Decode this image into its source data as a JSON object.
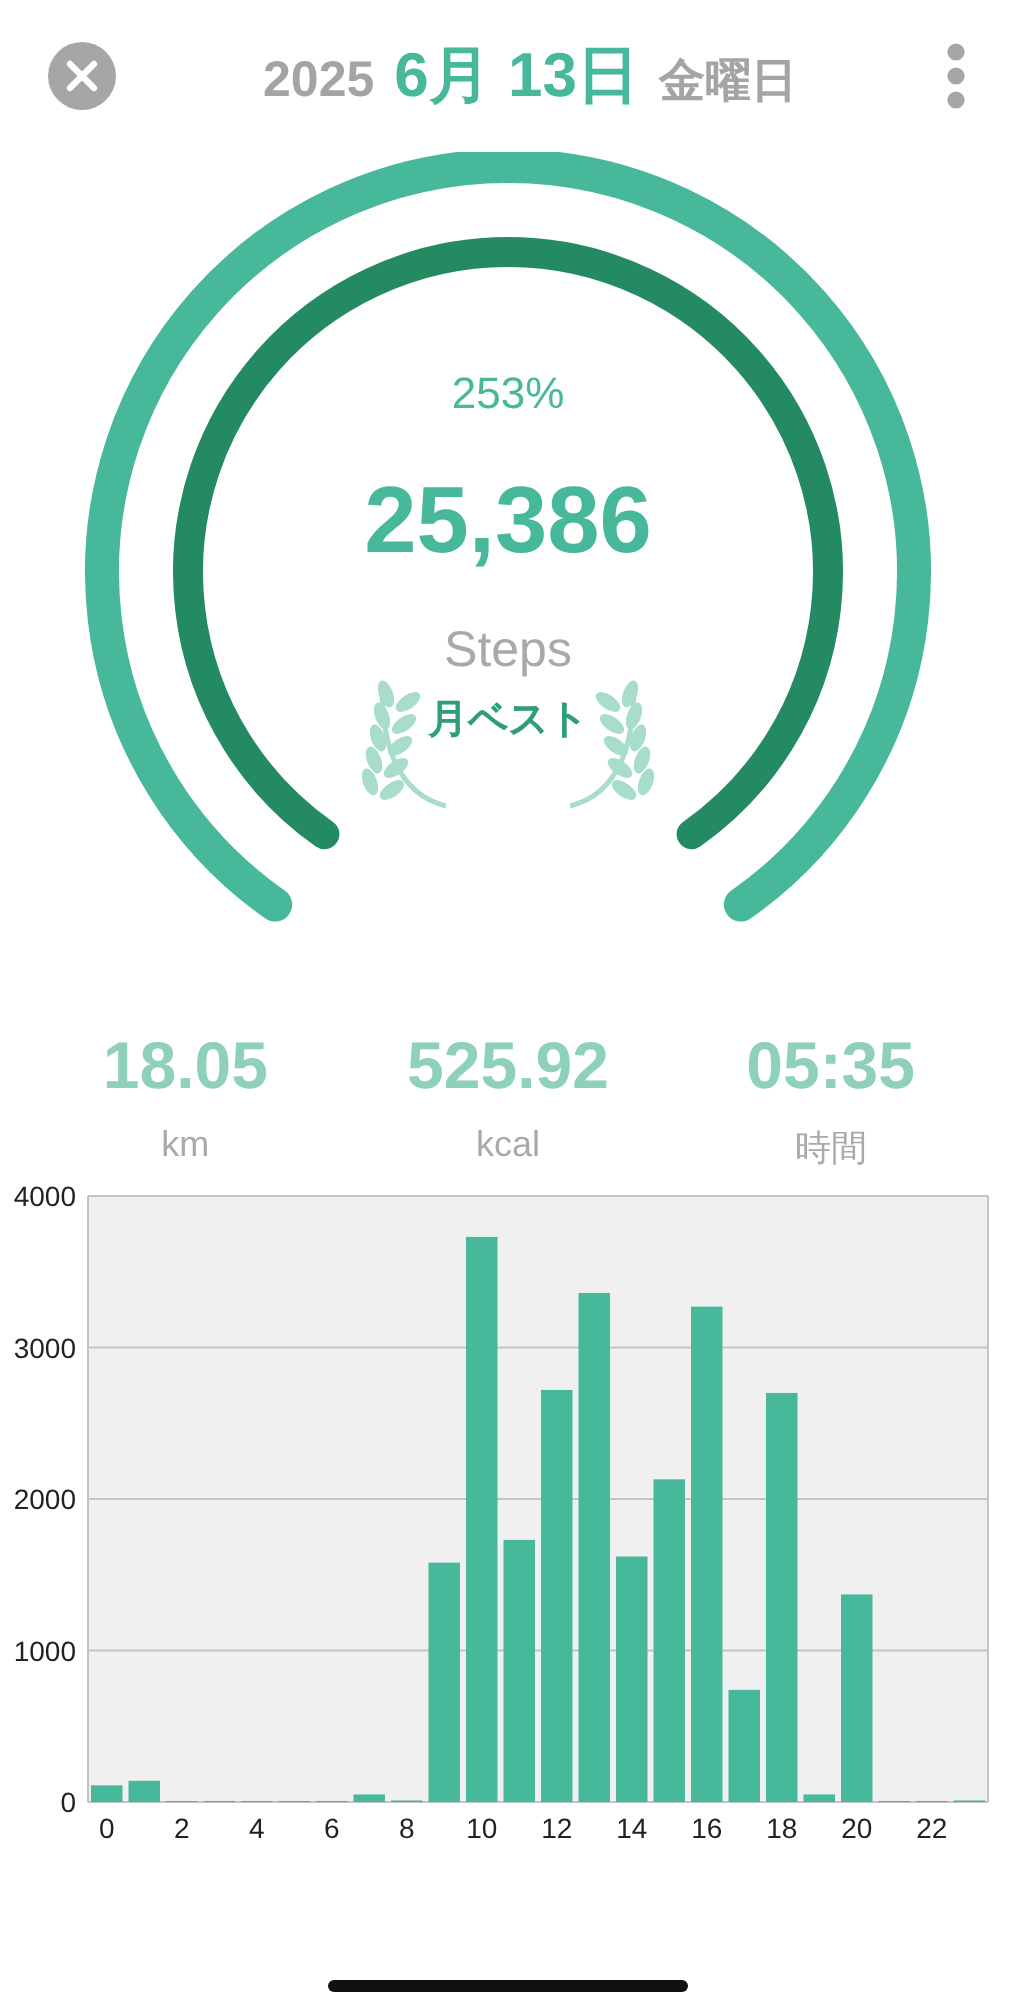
{
  "header": {
    "year": "2025",
    "date": "6月 13日",
    "weekday": "金曜日"
  },
  "gauge": {
    "percent": "253%",
    "steps": "25,386",
    "unit": "Steps",
    "badge": "月ベスト"
  },
  "stats": [
    {
      "value": "18.05",
      "label": "km"
    },
    {
      "value": "525.92",
      "label": "kcal"
    },
    {
      "value": "05:35",
      "label": "時間"
    }
  ],
  "chart_data": {
    "type": "bar",
    "x": [
      0,
      1,
      2,
      3,
      4,
      5,
      6,
      7,
      8,
      9,
      10,
      11,
      12,
      13,
      14,
      15,
      16,
      17,
      18,
      19,
      20,
      21,
      22,
      23
    ],
    "values": [
      110,
      140,
      0,
      0,
      0,
      0,
      0,
      50,
      10,
      1580,
      3730,
      1730,
      2720,
      3360,
      1620,
      2130,
      3270,
      740,
      2700,
      50,
      1370,
      0,
      0,
      10
    ],
    "grid": true,
    "xlim": [
      -0.5,
      23.5
    ],
    "ylim": [
      0,
      4000
    ],
    "xticks": [
      0,
      2,
      4,
      6,
      8,
      10,
      12,
      14,
      16,
      18,
      20,
      22
    ],
    "yticks": [
      0,
      1000,
      2000,
      3000,
      4000
    ]
  }
}
